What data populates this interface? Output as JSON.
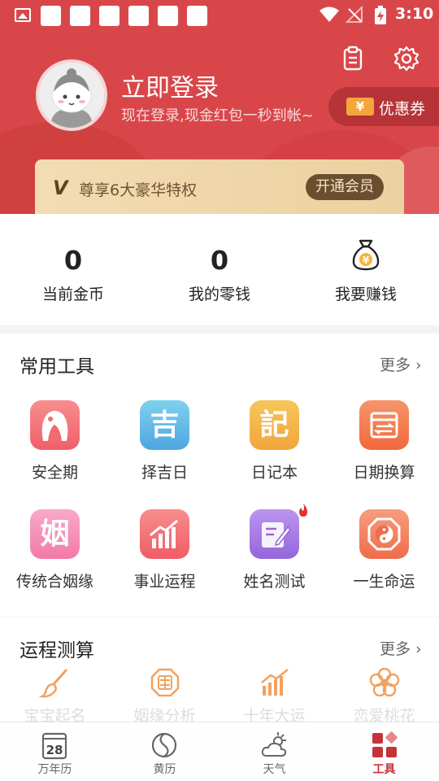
{
  "status_bar": {
    "time": "3:10"
  },
  "header": {
    "login_title": "立即登录",
    "login_subtitle": "现在登录,现金红包一秒到帐~",
    "coupon_label": "优惠券",
    "coupon_ticket": "¥",
    "vip_logo": "V",
    "vip_text": "尊享6大豪华特权",
    "vip_button": "开通会员"
  },
  "wallet": [
    {
      "value": "0",
      "label": "当前金币"
    },
    {
      "value": "0",
      "label": "我的零钱"
    },
    {
      "label": "我要赚钱",
      "icon": "money-bag-icon"
    }
  ],
  "common_tools": {
    "title": "常用工具",
    "more": "更多",
    "items": [
      {
        "label": "安全期",
        "icon": "safe-period-icon",
        "color": "#f26b70"
      },
      {
        "label": "择吉日",
        "icon": "auspicious-day-icon",
        "glyph": "吉",
        "color": "#62b7e6"
      },
      {
        "label": "日记本",
        "icon": "diary-icon",
        "glyph": "記",
        "color": "#f2b54a"
      },
      {
        "label": "日期换算",
        "icon": "date-convert-icon",
        "color": "#f27a4b"
      },
      {
        "label": "传统合姻缘",
        "icon": "marriage-icon",
        "glyph": "姻",
        "color": "#f48bb3"
      },
      {
        "label": "事业运程",
        "icon": "career-chart-icon",
        "color": "#f06f72"
      },
      {
        "label": "姓名测试",
        "icon": "name-test-icon",
        "color": "#a77de0",
        "badge": "hot"
      },
      {
        "label": "一生命运",
        "icon": "yin-yang-icon",
        "color": "#f07e5c"
      }
    ]
  },
  "fortune": {
    "title": "运程测算",
    "more": "更多",
    "items": [
      {
        "label": "宝宝起名",
        "icon": "brush-icon"
      },
      {
        "label": "姻缘分析",
        "icon": "double-happiness-icon"
      },
      {
        "label": "十年大运",
        "icon": "fortune-chart-icon"
      },
      {
        "label": "恋爱桃花",
        "icon": "peach-blossom-icon"
      }
    ]
  },
  "bottom_nav": [
    {
      "label": "万年历",
      "icon": "calendar-icon",
      "day": "28"
    },
    {
      "label": "黄历",
      "icon": "almanac-icon"
    },
    {
      "label": "天气",
      "icon": "weather-icon"
    },
    {
      "label": "工具",
      "icon": "tools-icon",
      "active": true
    }
  ]
}
